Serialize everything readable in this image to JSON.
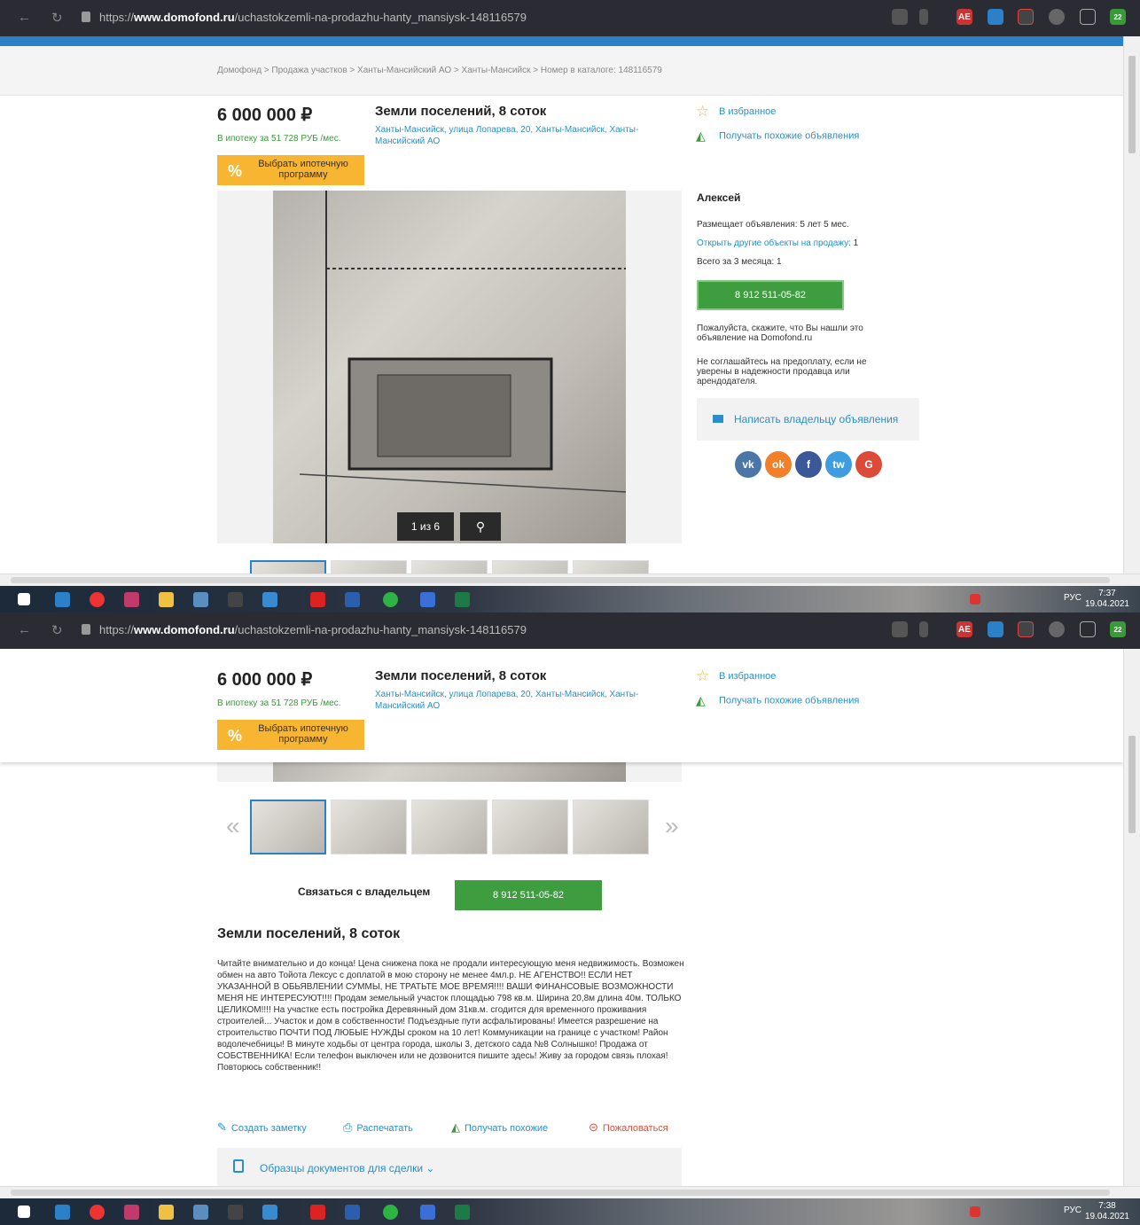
{
  "browser": {
    "url_scheme": "https://",
    "url_host": "www.domofond.ru",
    "url_path": "/uchastokzemli-na-prodazhu-hanty_mansiysk-148116579",
    "ext_badge": "AE",
    "tab_badge": "22"
  },
  "breadcrumb": "Домофонд > Продажа участков > Ханты-Мансийский АО > Ханты-Мансийск > Номер в каталоге: 148116579",
  "listing": {
    "price": "6 000 000 ₽",
    "mortgage": "В ипотеку за 51 728 РУБ /мес.",
    "mortgage_btn_symbol": "%",
    "mortgage_btn": "Выбрать ипотечную программу",
    "title": "Земли поселений, 8 соток",
    "address": "Ханты-Мансийск, улица Лопарева, 20, Ханты-Мансийск, Ханты-Мансийский АО"
  },
  "actions_top": {
    "favorite": "В избранное",
    "similar": "Получать похожие объявления"
  },
  "gallery": {
    "counter": "1 из 6",
    "zoom_icon": "magnifier-icon",
    "thumb_count": 6
  },
  "seller": {
    "name": "Алексей",
    "posting_since": "Размещает объявления: 5 лет 5 мес.",
    "other_link": "Открыть другие объекты на продажу:",
    "other_count": "1",
    "total": "Всего за 3 месяца: 1",
    "phone": "8 912 511-05-82",
    "note1": "Пожалуйста, скажите, что Вы нашли это объявление на Domofond.ru",
    "note2": "Не соглашайтесь на предоплату, если не уверены в надежности продавца или арендодателя.",
    "write": "Написать владельцу объявления",
    "social": [
      "vk",
      "ok",
      "f",
      "tw",
      "G"
    ]
  },
  "contact": {
    "label": "Связаться с владельцем",
    "phone": "8 912 511-05-82"
  },
  "description": {
    "heading": "Земли поселений, 8 соток",
    "text": "Читайте внимательно и до конца! Цена снижена пока не продали интересующую меня недвижимость. Возможен обмен на авто Тойота Лексус с доплатой в мою сторону не менее 4мл.р. НЕ АГЕНСТВО!! ЕСЛИ НЕТ УКАЗАННОЙ В ОБЬЯВЛЕНИИ СУММЫ, НЕ ТРАТЬТЕ МОЕ ВРЕМЯ!!!! ВАШИ ФИНАНСОВЫЕ ВОЗМОЖНОСТИ МЕНЯ НЕ ИНТЕРЕСУЮТ!!!! Продам земельный участок площадью 798 кв.м. Ширина 20,8м длина 40м. ТОЛЬКО ЦЕЛИКОМ!!!! На участке есть постройка Деревянный дом 31кв.м. сгодится для временного проживания строителей... Участок и дом в собственности! Подъездные пути асфальтированы! Имеется разрешение на строительство ПОЧТИ ПОД ЛЮБЫЕ НУЖДЫ сроком на 10 лет! Коммуникации на границе с участком! Район водолечебницы! В минуте ходьбы от центра города, школы 3, детского сада №8 Солнышко! Продажа от СОБСТВЕННИКА! Если телефон выключен или не дозвонится пишите здесь! Живу за городом связь плохая! Повторюсь собственник!!"
  },
  "bottom_actions": {
    "note": "Создать заметку",
    "print": "Распечатать",
    "similar": "Получать похожие",
    "complain": "Пожаловаться"
  },
  "docs": "Образцы документов для сделки",
  "taskbar": {
    "lang": "РУС",
    "time1": "7:37",
    "time2": "7:38",
    "date": "19.04.2021"
  }
}
